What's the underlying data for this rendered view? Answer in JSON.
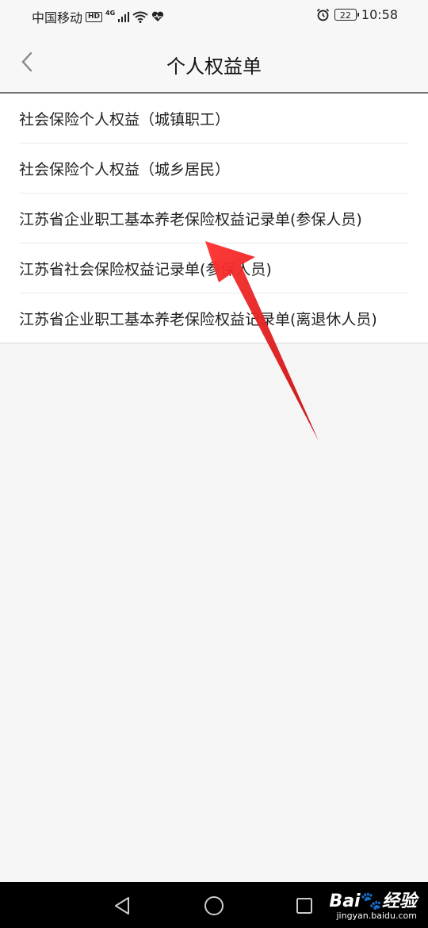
{
  "status_bar": {
    "carrier": "中国移动",
    "hd": "HD",
    "network": "4G",
    "battery": "22",
    "time": "10:58"
  },
  "header": {
    "title": "个人权益单"
  },
  "list": {
    "items": [
      {
        "label": "社会保险个人权益（城镇职工）"
      },
      {
        "label": "社会保险个人权益（城乡居民）"
      },
      {
        "label": "江苏省企业职工基本养老保险权益记录单(参保人员)"
      },
      {
        "label": "江苏省社会保险权益记录单(参保人员)"
      },
      {
        "label": "江苏省企业职工基本养老保险权益记录单(离退休人员)"
      }
    ]
  },
  "watermark": {
    "brand_a": "Bai",
    "brand_b": "经验",
    "url": "jingyan.baidu.com"
  },
  "colors": {
    "arrow": "#e0181c",
    "background": "#f5f5f5"
  }
}
